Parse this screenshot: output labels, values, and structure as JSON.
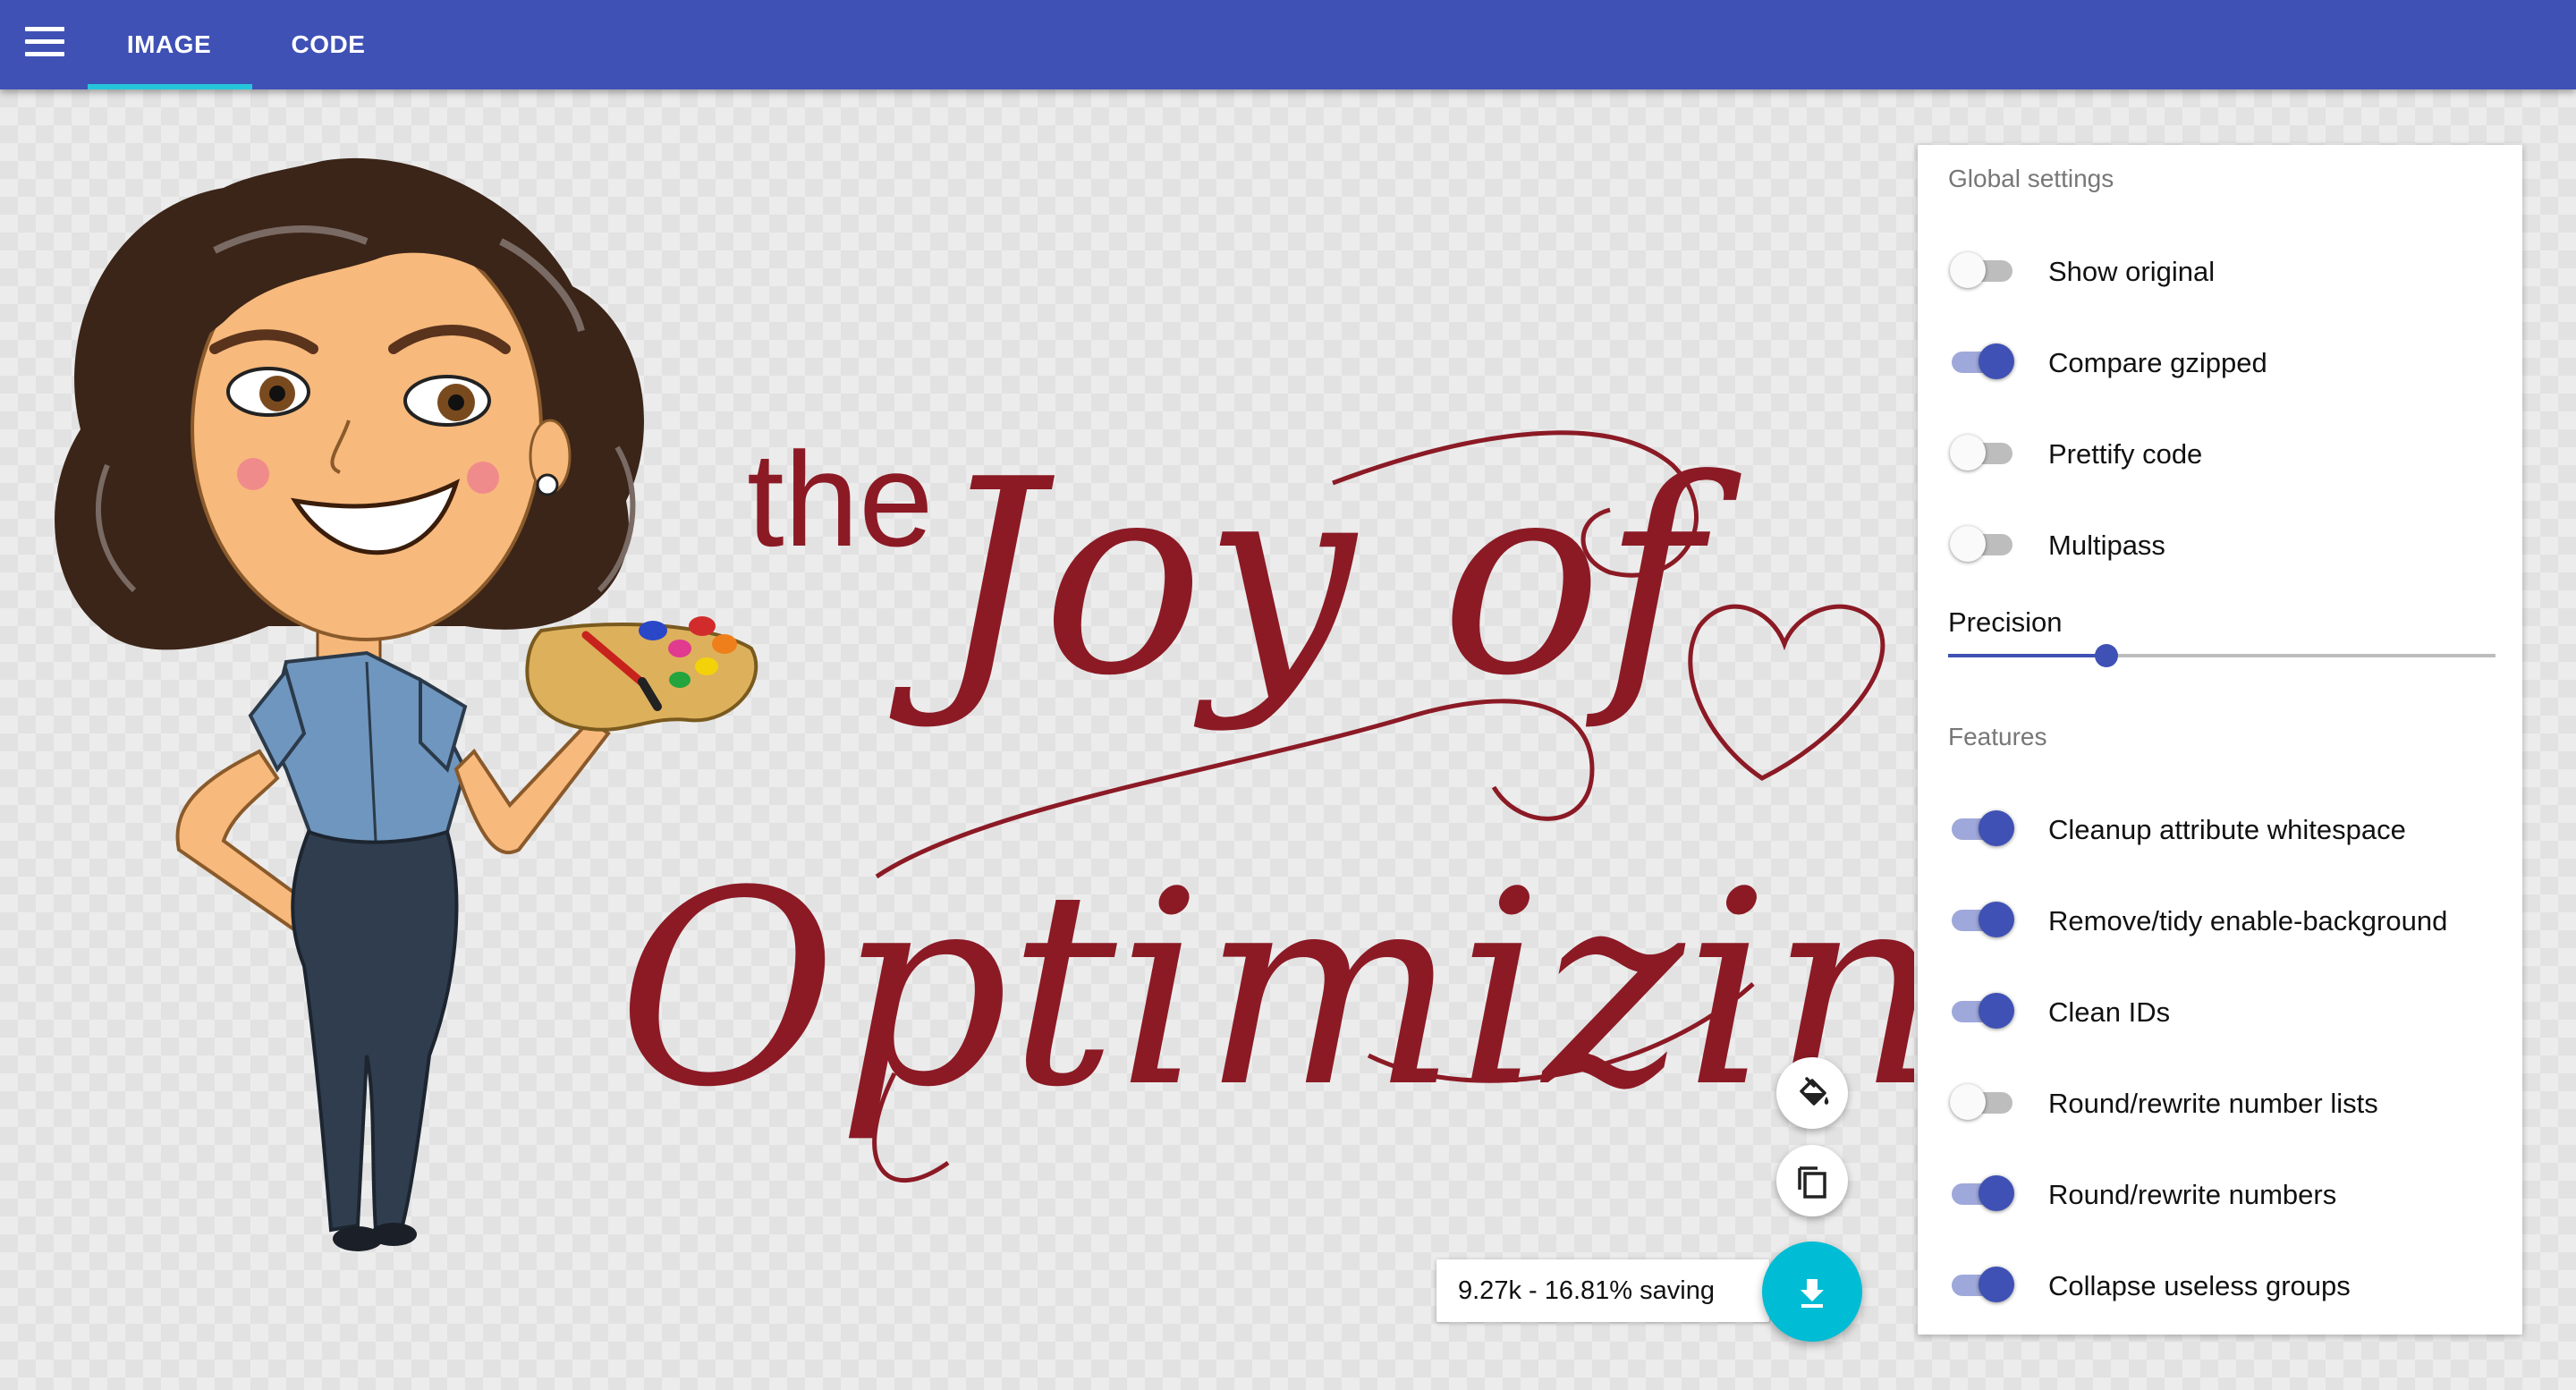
{
  "toolbar": {
    "menu_icon": "menu-icon",
    "tabs": [
      {
        "label": "IMAGE",
        "active": true
      },
      {
        "label": "CODE",
        "active": false
      }
    ],
    "color": "#3f51b5",
    "indicator_color": "#26c6da"
  },
  "artwork": {
    "title_lines": [
      "the",
      "Joy of",
      "Optimizing"
    ],
    "lettering_color": "#8b1a25"
  },
  "settings": {
    "global_heading": "Global settings",
    "global": [
      {
        "label": "Show original",
        "on": false
      },
      {
        "label": "Compare gzipped",
        "on": true
      },
      {
        "label": "Prettify code",
        "on": false
      },
      {
        "label": "Multipass",
        "on": false
      }
    ],
    "precision": {
      "label": "Precision",
      "value_fraction": 0.29
    },
    "features_heading": "Features",
    "features": [
      {
        "label": "Cleanup attribute whitespace",
        "on": true
      },
      {
        "label": "Remove/tidy enable-background",
        "on": true
      },
      {
        "label": "Clean IDs",
        "on": true
      },
      {
        "label": "Round/rewrite number lists",
        "on": false
      },
      {
        "label": "Round/rewrite numbers",
        "on": true
      },
      {
        "label": "Collapse useless groups",
        "on": true
      }
    ]
  },
  "actions": {
    "bg_toggle_icon": "paint-bucket-icon",
    "copy_icon": "copy-icon",
    "download_icon": "download-icon",
    "result_text": "9.27k - 16.81% saving"
  }
}
